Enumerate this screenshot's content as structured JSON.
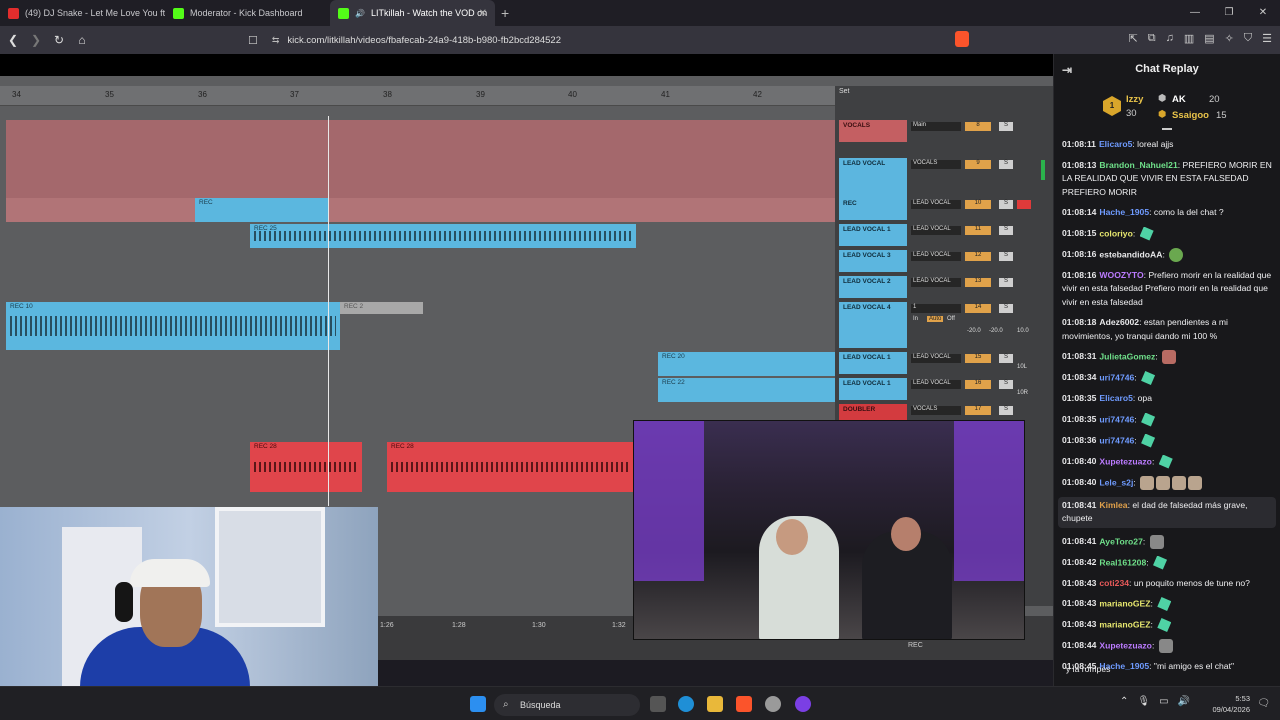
{
  "browser": {
    "tabs": [
      {
        "title": "(49) DJ Snake - Let Me Love You ft. Ju",
        "color": "#e32d2d",
        "active": false
      },
      {
        "title": "Moderator - Kick Dashboard",
        "color": "#53fc18",
        "active": false
      },
      {
        "title": "LITkillah - Watch the VOD on",
        "color": "#53fc18",
        "active": true
      }
    ],
    "url": "kick.com/litkillah/videos/fbafecab-24a9-418b-b980-fb2bcd284522"
  },
  "daw": {
    "ruler": [
      "34",
      "35",
      "36",
      "37",
      "38",
      "39",
      "40",
      "41",
      "42"
    ],
    "set_label": "Set",
    "clips": {
      "rec": "REC",
      "rec25": "REC 25",
      "rec10": "REC 10",
      "rec2": "REC 2",
      "rec20": "REC 20",
      "rec22": "REC 22",
      "rec28": "REC 28",
      "rec29": "REC 29"
    },
    "tracks": [
      {
        "name": "VOCALS",
        "sel": "Main",
        "vol": "8"
      },
      {
        "name": "LEAD VOCAL",
        "sel": "VOCALS",
        "vol": "9"
      },
      {
        "name": "REC",
        "sel": "LEAD VOCAL",
        "vol": "10"
      },
      {
        "name": "LEAD VOCAL 1",
        "sel": "LEAD VOCAL",
        "vol": "11"
      },
      {
        "name": "LEAD VOCAL 3",
        "sel": "LEAD VOCAL",
        "vol": "12"
      },
      {
        "name": "LEAD VOCAL 2",
        "sel": "LEAD VOCAL",
        "vol": "13"
      },
      {
        "name": "LEAD VOCAL 4",
        "sel": "1",
        "vol": "14"
      },
      {
        "name": "LEAD VOCAL 1",
        "sel": "LEAD VOCAL",
        "vol": "15"
      },
      {
        "name": "LEAD VOCAL 1",
        "sel": "LEAD VOCAL",
        "vol": "16"
      },
      {
        "name": "DOUBLER",
        "sel": "VOCALS",
        "vol": "17"
      }
    ],
    "mixer_extra": {
      "in": "In",
      "auto": "Auto",
      "off": "Off",
      "db1": "-20.0",
      "db2": "-20.0",
      "db3": "10.0",
      "pan1": "10L",
      "pan2": "10R",
      "val3": "-3.0",
      "val2": "2.0"
    },
    "time_marks": [
      "1:26",
      "1:28",
      "1:30",
      "1:32"
    ],
    "rec_label": "REC"
  },
  "chat": {
    "title": "Chat Replay",
    "leaders": {
      "first": {
        "name": "Izzy",
        "count": "30",
        "rank": "1"
      },
      "second": {
        "name": "AK",
        "count": "20"
      },
      "third": {
        "name": "Ssaigoo",
        "count": "15"
      }
    },
    "messages": [
      {
        "time": "01:08:11",
        "user": "Elicaro5",
        "color": "#6f9bff",
        "text": "loreal ajjs"
      },
      {
        "time": "01:08:13",
        "user": "Brandon_Nahuel21",
        "color": "#6fe08a",
        "text": "PREFIERO MORIR EN LA REALIDAD QUE VIVIR EN ESTA FALSEDAD PREFIERO MORIR"
      },
      {
        "time": "01:08:14",
        "user": "Hache_1905",
        "color": "#6f9bff",
        "text": "como la del chat ?"
      },
      {
        "time": "01:08:15",
        "user": "coloriyo",
        "color": "#e8e86f",
        "text": "",
        "emote": "em-leaf"
      },
      {
        "time": "01:08:16",
        "user": "estebandidoAA",
        "color": "#e8e8ea",
        "text": "",
        "emote": "em-frog"
      },
      {
        "time": "01:08:16",
        "user": "WOOZYTO",
        "color": "#bb7bff",
        "text": "Prefiero morir en la realidad que vivir en esta falsedad Prefiero morir en la realidad que vivir en esta falsedad"
      },
      {
        "time": "01:08:18",
        "user": "Adez6002",
        "color": "#e8e8ea",
        "text": "estan pendientes a mi movimientos, yo tranqui dando mi 100 %"
      },
      {
        "time": "01:08:31",
        "user": "JulietaGomez",
        "color": "#6fe08a",
        "text": "",
        "emote": "em-pic"
      },
      {
        "time": "01:08:34",
        "user": "uri74746",
        "color": "#6f9bff",
        "text": "",
        "emote": "em-leaf"
      },
      {
        "time": "01:08:35",
        "user": "Elicaro5",
        "color": "#6f9bff",
        "text": "opa"
      },
      {
        "time": "01:08:35",
        "user": "uri74746",
        "color": "#6f9bff",
        "text": "",
        "emote": "em-leaf"
      },
      {
        "time": "01:08:36",
        "user": "uri74746",
        "color": "#6f9bff",
        "text": "",
        "emote": "em-leaf"
      },
      {
        "time": "01:08:40",
        "user": "Xupetezuazo",
        "color": "#bb7bff",
        "text": "",
        "emote": "em-leaf"
      },
      {
        "time": "01:08:40",
        "user": "Lele_s2j",
        "color": "#6f9bff",
        "text": "",
        "emote": "em-cat"
      },
      {
        "time": "01:08:41",
        "user": "Kimlea",
        "color": "#e0a04a",
        "text": "el dad de falsedad más grave, chupete",
        "highlight": true
      },
      {
        "time": "01:08:41",
        "user": "AyeToro27",
        "color": "#6fe08a",
        "text": "",
        "emote": "em-pc"
      },
      {
        "time": "01:08:42",
        "user": "Real161208",
        "color": "#6fe08a",
        "text": "",
        "emote": "em-leaf"
      },
      {
        "time": "01:08:43",
        "user": "coti234",
        "color": "#e85a5a",
        "text": "un poquito menos de tune no?"
      },
      {
        "time": "01:08:43",
        "user": "marianoGEZ",
        "color": "#e8e86f",
        "text": "",
        "emote": "em-leaf"
      },
      {
        "time": "01:08:43",
        "user": "marianoGEZ",
        "color": "#e8e86f",
        "text": "",
        "emote": "em-leaf"
      },
      {
        "time": "01:08:44",
        "user": "Xupetezuazo",
        "color": "#bb7bff",
        "text": "",
        "emote": "em-pc"
      },
      {
        "time": "01:08:45",
        "user": "Hache_1905",
        "color": "#6f9bff",
        "text": "\"mi amigo es el chat\""
      }
    ],
    "partial": "y la rompes"
  },
  "taskbar": {
    "search": "Búsqueda",
    "time": "5:53",
    "date": "09/04/2026"
  }
}
